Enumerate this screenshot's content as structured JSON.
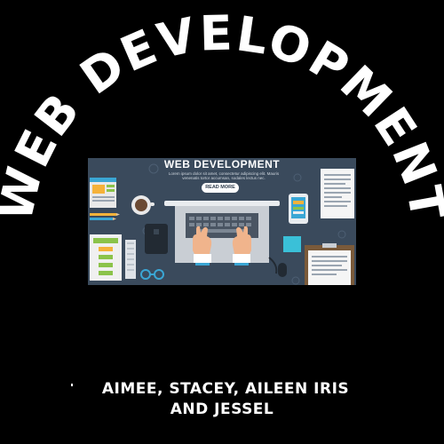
{
  "poster": {
    "arc_title": "WEB DEVELOPMENT",
    "authors_line1": "AIMEE, STACEY, AILEEN IRIS",
    "authors_line2": "AND JESSEL"
  },
  "banner": {
    "title": "WEB DEVELOPMENT",
    "lorem": "Lorem ipsum dolor sit amet, consectetur adipiscing elit. Mauris venenatis tortor accumsan, sodales lectus nec.",
    "button_label": "READ MORE"
  },
  "colors": {
    "background": "#000000",
    "banner_background": "#3a4a5c",
    "text": "#ffffff"
  }
}
